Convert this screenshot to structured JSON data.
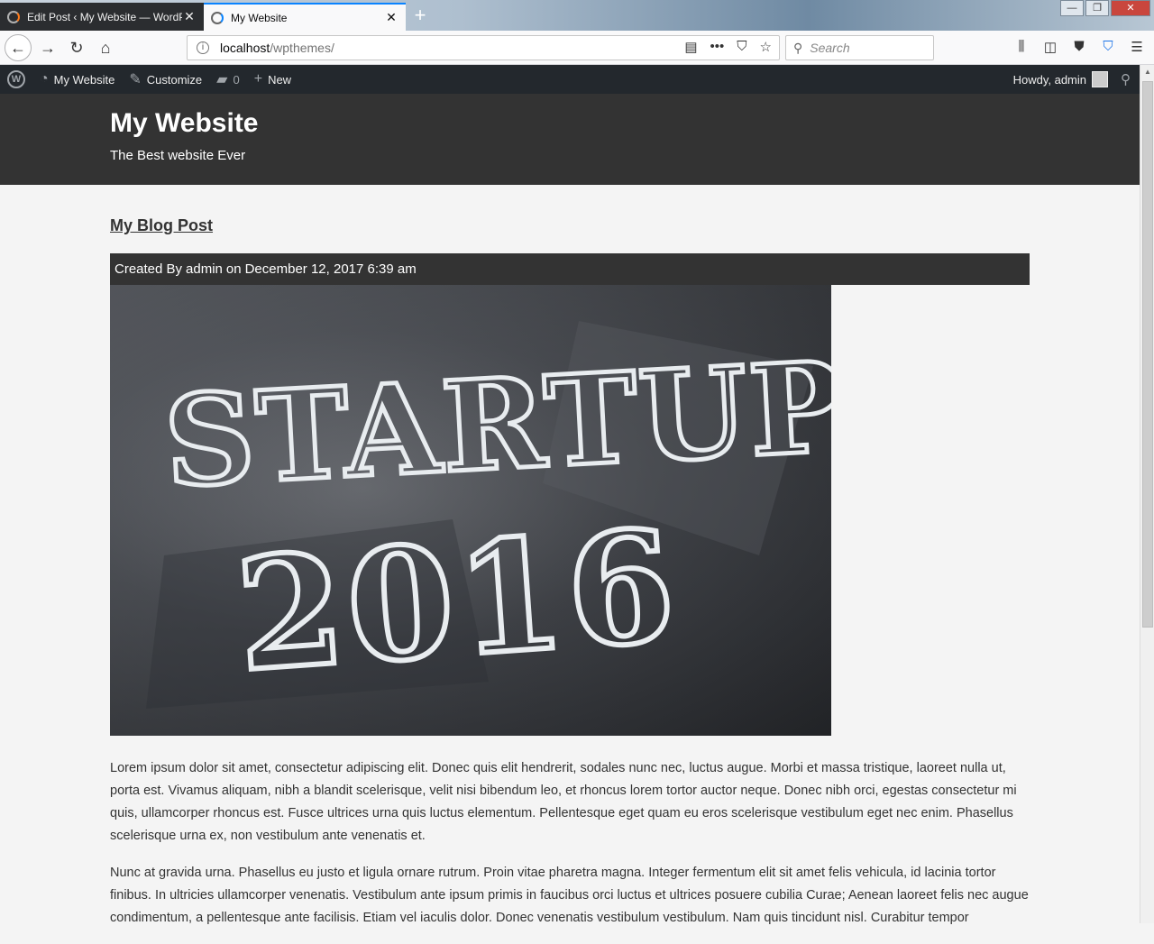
{
  "browser": {
    "tabs": [
      {
        "title": "Edit Post ‹ My Website — WordPress",
        "close": "✕"
      },
      {
        "title": "My Website",
        "close": "✕"
      }
    ],
    "newtab": "+",
    "window_controls": {
      "minimize": "—",
      "restore": "❐",
      "close": "✕"
    },
    "url": {
      "host": "localhost",
      "path": "/wpthemes/"
    },
    "search_placeholder": "Search"
  },
  "adminbar": {
    "site_name": "My Website",
    "customize": "Customize",
    "comments_count": "0",
    "new_label": "New",
    "howdy": "Howdy, admin"
  },
  "site": {
    "title": "My Website",
    "description": "The Best website Ever"
  },
  "post": {
    "title": "My Blog Post",
    "meta_prefix": "Created By",
    "author": "admin",
    "meta_on": "on",
    "date": "December 12, 2017 6:39 am",
    "image_text": {
      "line1": "STARTUP",
      "line2": "2016"
    },
    "paragraphs": [
      "Lorem ipsum dolor sit amet, consectetur adipiscing elit. Donec quis elit hendrerit, sodales nunc nec, luctus augue. Morbi et massa tristique, laoreet nulla ut, porta est. Vivamus aliquam, nibh a blandit scelerisque, velit nisi bibendum leo, et rhoncus lorem tortor auctor neque. Donec nibh orci, egestas consectetur mi quis, ullamcorper rhoncus est. Fusce ultrices urna quis luctus elementum. Pellentesque eget quam eu eros scelerisque vestibulum eget nec enim. Phasellus scelerisque urna ex, non vestibulum ante venenatis et.",
      "Nunc at gravida urna. Phasellus eu justo et ligula ornare rutrum. Proin vitae pharetra magna. Integer fermentum elit sit amet felis vehicula, id lacinia tortor finibus. In ultricies ullamcorper venenatis. Vestibulum ante ipsum primis in faucibus orci luctus et ultrices posuere cubilia Curae; Aenean laoreet felis nec augue condimentum, a pellentesque ante facilisis. Etiam vel iaculis dolor. Donec venenatis vestibulum vestibulum. Nam quis tincidunt nisl. Curabitur tempor"
    ]
  }
}
